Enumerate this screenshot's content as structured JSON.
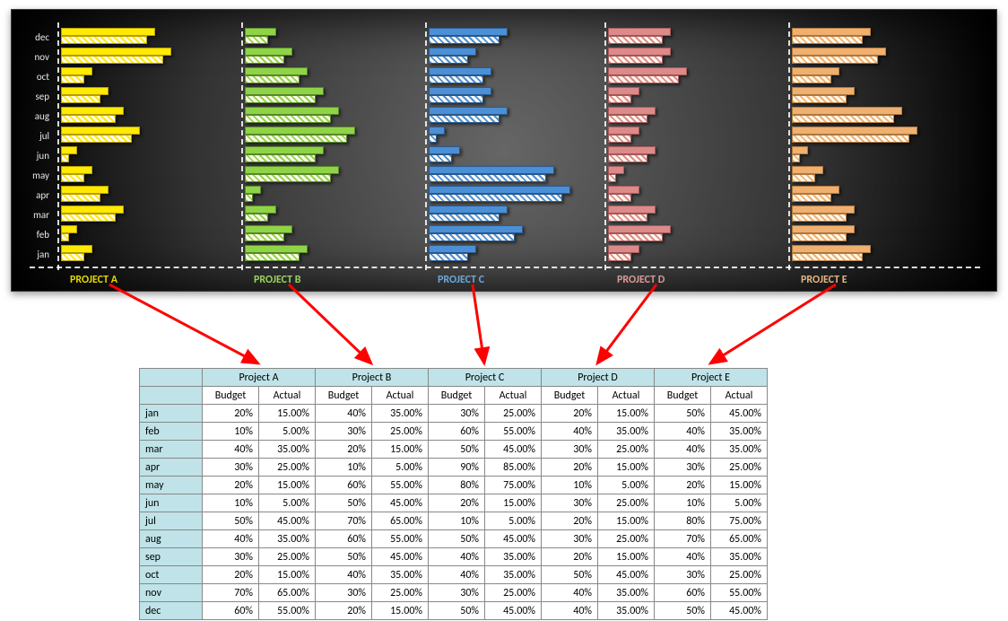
{
  "months": [
    "jan",
    "feb",
    "mar",
    "apr",
    "may",
    "jun",
    "jul",
    "aug",
    "sep",
    "oct",
    "nov",
    "dec"
  ],
  "subheaders": [
    "Budget",
    "Actual"
  ],
  "projects": [
    {
      "name": "Project A",
      "chart_label": "PROJECT A",
      "solid": "#ffea00",
      "edge": "#b89f00",
      "label_color": "#e4d800",
      "budget": [
        20,
        10,
        40,
        30,
        20,
        10,
        50,
        40,
        30,
        20,
        70,
        60
      ],
      "actual": [
        15,
        5,
        35,
        25,
        15,
        5,
        45,
        35,
        25,
        15,
        65,
        55
      ]
    },
    {
      "name": "Project B",
      "chart_label": "PROJECT B",
      "solid": "#8fd446",
      "edge": "#5a8a2a",
      "label_color": "#98d25e",
      "budget": [
        40,
        30,
        20,
        10,
        60,
        50,
        70,
        60,
        50,
        40,
        30,
        20
      ],
      "actual": [
        35,
        25,
        15,
        5,
        55,
        45,
        65,
        55,
        45,
        35,
        25,
        15
      ]
    },
    {
      "name": "Project C",
      "chart_label": "PROJECT C",
      "solid": "#4b8fd6",
      "edge": "#2a5a8f",
      "label_color": "#6aa7da",
      "budget": [
        30,
        60,
        50,
        90,
        80,
        20,
        10,
        50,
        40,
        40,
        30,
        50
      ],
      "actual": [
        25,
        55,
        45,
        85,
        75,
        15,
        5,
        45,
        35,
        35,
        25,
        45
      ]
    },
    {
      "name": "Project D",
      "chart_label": "PROJECT D",
      "solid": "#dd8a8a",
      "edge": "#a55a5a",
      "label_color": "#d99999",
      "budget": [
        20,
        40,
        30,
        20,
        10,
        30,
        20,
        30,
        20,
        50,
        40,
        40
      ],
      "actual": [
        15,
        35,
        25,
        15,
        5,
        25,
        15,
        25,
        15,
        45,
        35,
        35
      ]
    },
    {
      "name": "Project E",
      "chart_label": "PROJECT E",
      "solid": "#f0b070",
      "edge": "#b07a40",
      "label_color": "#e3b583",
      "budget": [
        50,
        40,
        40,
        30,
        20,
        10,
        80,
        70,
        40,
        30,
        60,
        50
      ],
      "actual": [
        45,
        35,
        35,
        25,
        15,
        5,
        75,
        65,
        35,
        25,
        55,
        45
      ]
    }
  ],
  "chart_data": [
    {
      "type": "bar",
      "title": "PROJECT A",
      "categories": [
        "jan",
        "feb",
        "mar",
        "apr",
        "may",
        "jun",
        "jul",
        "aug",
        "sep",
        "oct",
        "nov",
        "dec"
      ],
      "series": [
        {
          "name": "Budget",
          "values": [
            20,
            10,
            40,
            30,
            20,
            10,
            50,
            40,
            30,
            20,
            70,
            60
          ]
        },
        {
          "name": "Actual",
          "values": [
            15,
            5,
            35,
            25,
            15,
            5,
            45,
            35,
            25,
            15,
            65,
            55
          ]
        }
      ],
      "xlim": [
        0,
        100
      ],
      "xlabel": "",
      "ylabel": ""
    },
    {
      "type": "bar",
      "title": "PROJECT B",
      "categories": [
        "jan",
        "feb",
        "mar",
        "apr",
        "may",
        "jun",
        "jul",
        "aug",
        "sep",
        "oct",
        "nov",
        "dec"
      ],
      "series": [
        {
          "name": "Budget",
          "values": [
            40,
            30,
            20,
            10,
            60,
            50,
            70,
            60,
            50,
            40,
            30,
            20
          ]
        },
        {
          "name": "Actual",
          "values": [
            35,
            25,
            15,
            5,
            55,
            45,
            65,
            55,
            45,
            35,
            25,
            15
          ]
        }
      ],
      "xlim": [
        0,
        100
      ],
      "xlabel": "",
      "ylabel": ""
    },
    {
      "type": "bar",
      "title": "PROJECT C",
      "categories": [
        "jan",
        "feb",
        "mar",
        "apr",
        "may",
        "jun",
        "jul",
        "aug",
        "sep",
        "oct",
        "nov",
        "dec"
      ],
      "series": [
        {
          "name": "Budget",
          "values": [
            30,
            60,
            50,
            90,
            80,
            20,
            10,
            50,
            40,
            40,
            30,
            50
          ]
        },
        {
          "name": "Actual",
          "values": [
            25,
            55,
            45,
            85,
            75,
            15,
            5,
            45,
            35,
            35,
            25,
            45
          ]
        }
      ],
      "xlim": [
        0,
        100
      ],
      "xlabel": "",
      "ylabel": ""
    },
    {
      "type": "bar",
      "title": "PROJECT D",
      "categories": [
        "jan",
        "feb",
        "mar",
        "apr",
        "may",
        "jun",
        "jul",
        "aug",
        "sep",
        "oct",
        "nov",
        "dec"
      ],
      "series": [
        {
          "name": "Budget",
          "values": [
            20,
            40,
            30,
            20,
            10,
            30,
            20,
            30,
            20,
            50,
            40,
            40
          ]
        },
        {
          "name": "Actual",
          "values": [
            15,
            35,
            25,
            15,
            5,
            25,
            15,
            25,
            15,
            45,
            35,
            35
          ]
        }
      ],
      "xlim": [
        0,
        100
      ],
      "xlabel": "",
      "ylabel": ""
    },
    {
      "type": "bar",
      "title": "PROJECT E",
      "categories": [
        "jan",
        "feb",
        "mar",
        "apr",
        "may",
        "jun",
        "jul",
        "aug",
        "sep",
        "oct",
        "nov",
        "dec"
      ],
      "series": [
        {
          "name": "Budget",
          "values": [
            50,
            40,
            40,
            30,
            20,
            10,
            80,
            70,
            40,
            30,
            60,
            50
          ]
        },
        {
          "name": "Actual",
          "values": [
            45,
            35,
            35,
            25,
            15,
            5,
            75,
            65,
            35,
            25,
            55,
            45
          ]
        }
      ],
      "xlim": [
        0,
        100
      ],
      "xlabel": "",
      "ylabel": ""
    }
  ]
}
